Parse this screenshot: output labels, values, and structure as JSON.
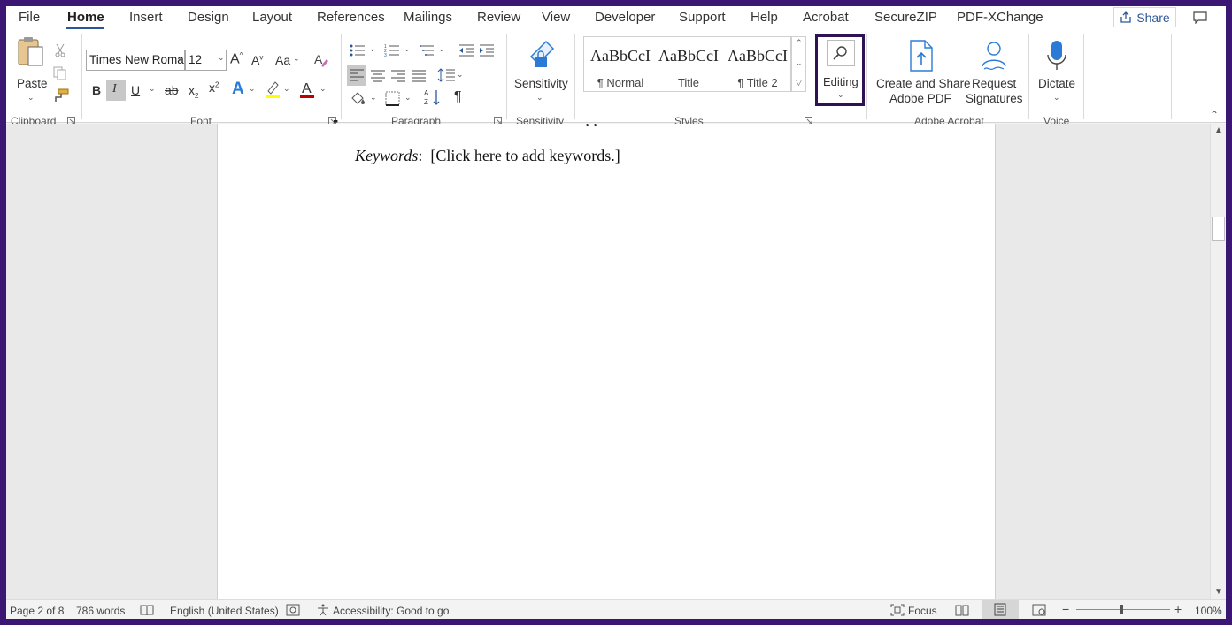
{
  "menu": {
    "tabs": [
      "File",
      "Home",
      "Insert",
      "Design",
      "Layout",
      "References",
      "Mailings",
      "Review",
      "View",
      "Developer",
      "Support",
      "Help",
      "Acrobat",
      "SecureZIP",
      "PDF-XChange"
    ],
    "active_tab": "Home",
    "share_label": "Share"
  },
  "ribbon": {
    "clipboard": {
      "paste_label": "Paste",
      "group_label": "Clipboard"
    },
    "font": {
      "font_name": "Times New Roma",
      "font_size": "12",
      "case_label": "Aa",
      "group_label": "Font",
      "bold": "B",
      "italic": "I",
      "underline": "U"
    },
    "paragraph": {
      "group_label": "Paragraph"
    },
    "sensitivity": {
      "button_label": "Sensitivity",
      "group_label": "Sensitivity"
    },
    "styles": {
      "items": [
        {
          "sample": "AaBbCcI",
          "name": "¶ Normal"
        },
        {
          "sample": "AaBbCcI",
          "name": "Title"
        },
        {
          "sample": "AaBbCcI",
          "name": "¶ Title 2"
        }
      ],
      "group_label": "Styles"
    },
    "editing": {
      "button_label": "Editing"
    },
    "acrobat": {
      "create_share_line1": "Create and Share",
      "create_share_line2": "Adobe PDF",
      "request_line1": "Request",
      "request_line2": "Signatures",
      "group_label": "Adobe Acrobat"
    },
    "voice": {
      "dictate_label": "Dictate",
      "group_label": "Voice"
    }
  },
  "document": {
    "keywords_label": "Keywords",
    "keywords_sep": ":",
    "keywords_value": "[Click here to add keywords.]"
  },
  "statusbar": {
    "page": "Page 2 of 8",
    "words": "786 words",
    "language": "English (United States)",
    "accessibility": "Accessibility: Good to go",
    "focus": "Focus",
    "zoom": "100%"
  },
  "colors": {
    "accent": "#2b579a",
    "frame": "#3b1673",
    "highlight_box": "#2d1254",
    "font_color": "#c00000",
    "highlight_color": "#ffff00"
  }
}
